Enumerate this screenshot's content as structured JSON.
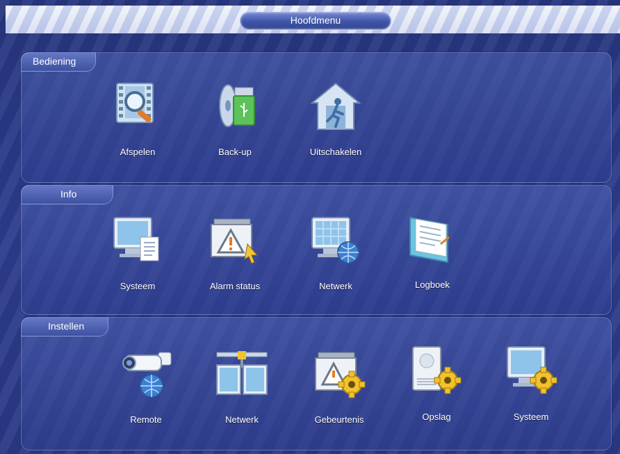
{
  "title": "Hoofdmenu",
  "sections": [
    {
      "label": "Bediening",
      "items": [
        {
          "label": "Afspelen",
          "icon": "playback-magnifier-icon"
        },
        {
          "label": "Back-up",
          "icon": "backup-disc-usb-icon"
        },
        {
          "label": "Uitschakelen",
          "icon": "exit-house-icon"
        }
      ]
    },
    {
      "label": "Info",
      "items": [
        {
          "label": "Systeem",
          "icon": "system-info-monitor-icon"
        },
        {
          "label": "Alarm status",
          "icon": "alarm-warning-icon"
        },
        {
          "label": "Netwerk",
          "icon": "network-globe-monitor-icon"
        },
        {
          "label": "Logboek",
          "icon": "logbook-icon"
        }
      ]
    },
    {
      "label": "Instellen",
      "items": [
        {
          "label": "Remote",
          "icon": "remote-camera-icon"
        },
        {
          "label": "Netwerk",
          "icon": "network-setup-icon"
        },
        {
          "label": "Gebeurtenis",
          "icon": "event-gear-icon"
        },
        {
          "label": "Opslag",
          "icon": "storage-gear-icon"
        },
        {
          "label": "Systeem",
          "icon": "system-gear-icon"
        }
      ]
    }
  ],
  "colors": {
    "background": "#2a3a86",
    "panel_tab": "#3d51a2",
    "text": "#ffffff",
    "gear": "#f2c12e"
  }
}
